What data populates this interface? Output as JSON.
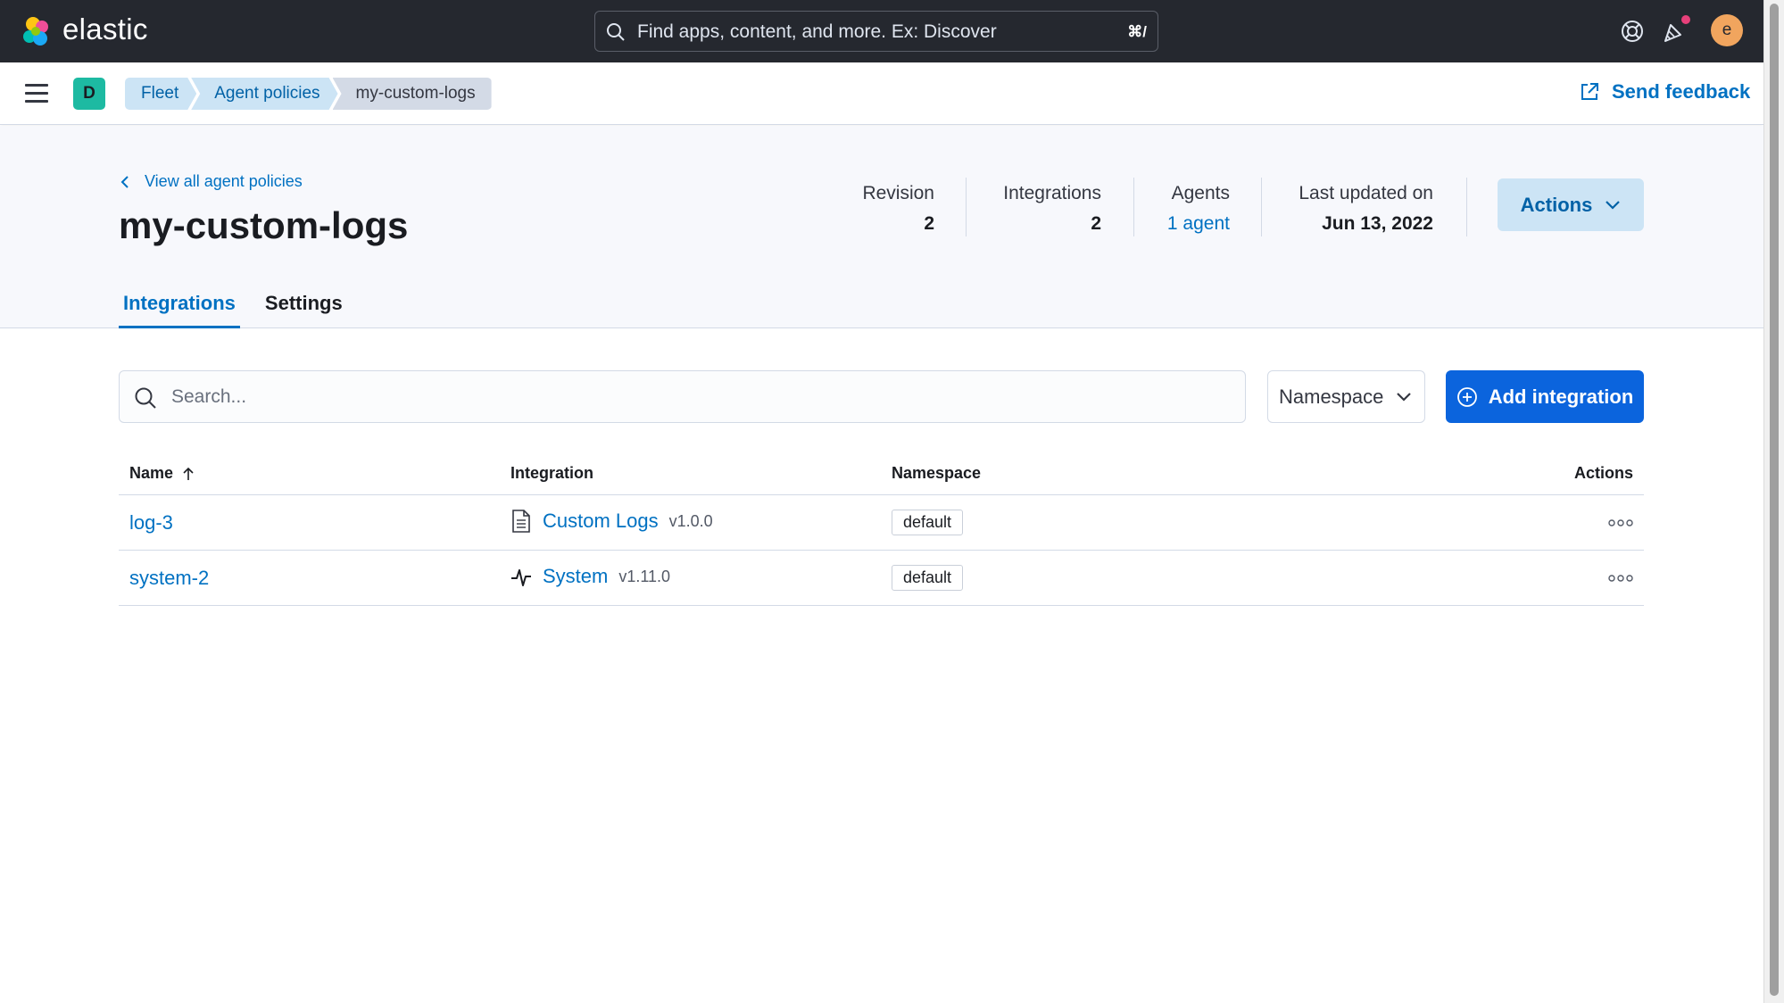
{
  "app": {
    "brand": "elastic"
  },
  "global_search": {
    "placeholder": "Find apps, content, and more. Ex: Discover",
    "shortcut": "⌘/"
  },
  "user": {
    "avatar_initial": "e"
  },
  "space": {
    "initial": "D"
  },
  "breadcrumbs": [
    "Fleet",
    "Agent policies",
    "my-custom-logs"
  ],
  "send_feedback": "Send feedback",
  "back_link": "View all agent policies",
  "policy": {
    "title": "my-custom-logs",
    "stats": {
      "revision_label": "Revision",
      "revision": "2",
      "integrations_label": "Integrations",
      "integrations": "2",
      "agents_label": "Agents",
      "agents": "1 agent",
      "updated_label": "Last updated on",
      "updated": "Jun 13, 2022"
    },
    "actions_label": "Actions"
  },
  "tabs": [
    "Integrations",
    "Settings"
  ],
  "toolbar": {
    "search_placeholder": "Search...",
    "namespace_label": "Namespace",
    "add_label": "Add integration"
  },
  "table": {
    "columns": [
      "Name",
      "Integration",
      "Namespace",
      "Actions"
    ],
    "rows": [
      {
        "name": "log-3",
        "integration": "Custom Logs",
        "version": "v1.0.0",
        "namespace": "default",
        "icon": "document-icon"
      },
      {
        "name": "system-2",
        "integration": "System",
        "version": "v1.11.0",
        "namespace": "default",
        "icon": "pulse-icon"
      }
    ]
  },
  "colors": {
    "accent": "#0071c2",
    "primary_button": "#0b64dd",
    "topbar": "#25282f",
    "space_badge": "#1dbaa2",
    "avatar": "#f1a55e"
  }
}
